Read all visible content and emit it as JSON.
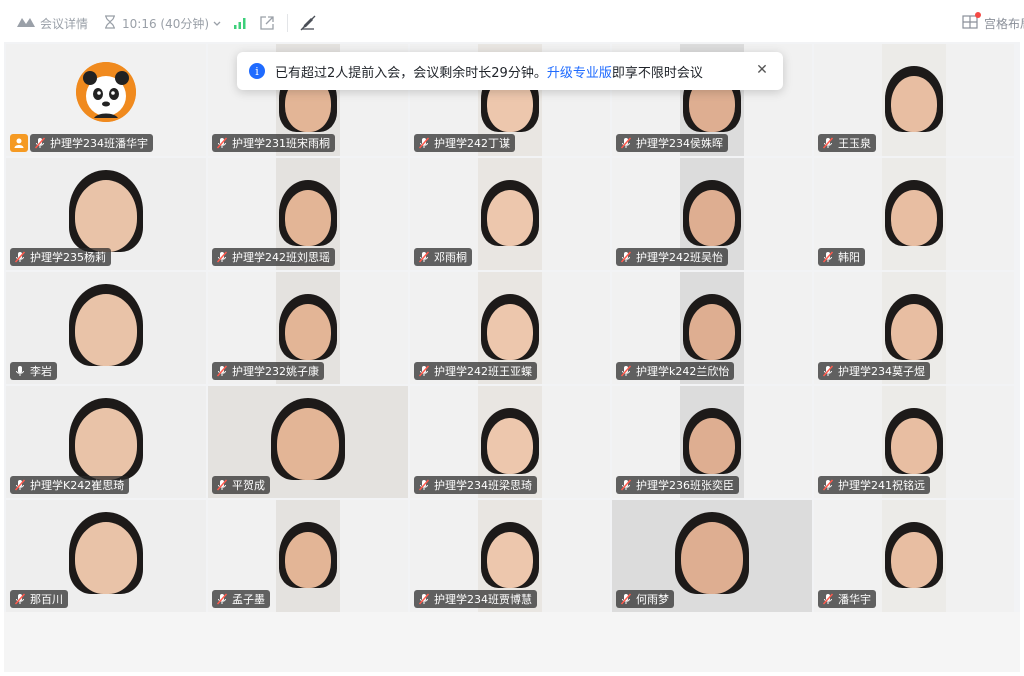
{
  "topbar": {
    "meeting_details": "会议详情",
    "time": "10:16 (40分钟)",
    "layout": "宫格布局"
  },
  "toast": {
    "message": "已有超过2人提前入会，会议剩余时长29分钟。",
    "link": "升级专业版",
    "suffix": "即享不限时会议"
  },
  "participants": [
    {
      "name": "护理学234班潘华宇",
      "host": true,
      "avatar": "panda-avatar"
    },
    {
      "name": "护理学231班宋雨桐"
    },
    {
      "name": "护理学242丁谋"
    },
    {
      "name": "护理学234侯姝晖"
    },
    {
      "name": "王玉泉"
    },
    {
      "name": "护理学235杨莉"
    },
    {
      "name": "护理学242班刘思瑶"
    },
    {
      "name": "邓雨桐"
    },
    {
      "name": "护理学242班吴怡"
    },
    {
      "name": "韩阳"
    },
    {
      "name": "李岩",
      "active": true
    },
    {
      "name": "护理学232姚子康"
    },
    {
      "name": "护理学242班王亚蝶"
    },
    {
      "name": "护理学k242兰欣怡"
    },
    {
      "name": "护理学234莫子煜"
    },
    {
      "name": "护理学K242崔思琦"
    },
    {
      "name": "平贺成"
    },
    {
      "name": "护理学234班梁思琦"
    },
    {
      "name": "护理学236班张奕臣"
    },
    {
      "name": "护理学241祝铭远"
    },
    {
      "name": "那百川"
    },
    {
      "name": "孟子墨"
    },
    {
      "name": "护理学234班贾博慧"
    },
    {
      "name": "何雨梦"
    },
    {
      "name": "潘华宇"
    }
  ],
  "colors": {
    "active_border": "#2fbf71",
    "host_badge": "#f59a23",
    "link": "#1f6bff"
  }
}
